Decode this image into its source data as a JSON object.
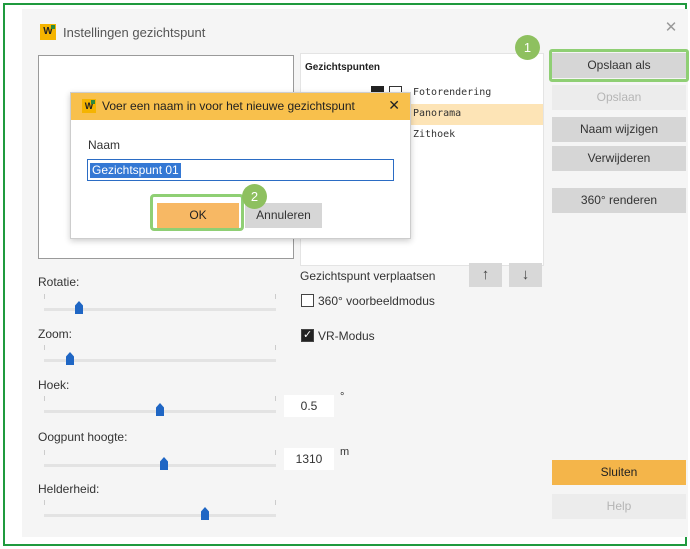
{
  "window": {
    "title": "Instellingen gezichtspunt",
    "icon": "app-logo-icon",
    "icon_letter": "W",
    "close_glyph": "✕"
  },
  "viewpoints": {
    "heading": "Gezichtspunten",
    "items": [
      {
        "label": "Fotorendering",
        "selected": false
      },
      {
        "label": "Panorama",
        "selected": true
      },
      {
        "label": "Zithoek",
        "selected": false
      }
    ]
  },
  "buttons": {
    "save_as": "Opslaan als",
    "save": "Opslaan",
    "rename": "Naam wijzigen",
    "delete": "Verwijderen",
    "render360": "360° renderen",
    "close": "Sluiten",
    "help": "Help"
  },
  "move": {
    "label": "Gezichtspunt verplaatsen",
    "up_glyph": "↑",
    "down_glyph": "↓"
  },
  "options": {
    "preview360": {
      "label": "360° voorbeeldmodus",
      "checked": false
    },
    "vr": {
      "label": "VR-Modus",
      "checked": true
    }
  },
  "sliders": {
    "rotation": {
      "label": "Rotatie:",
      "level": 0.14
    },
    "zoom": {
      "label": "Zoom:",
      "level": 0.1
    },
    "angle": {
      "label": "Hoek:",
      "level": 0.5,
      "value": "0.5",
      "unit": "°"
    },
    "eye_height": {
      "label": "Oogpunt hoogte:",
      "level": 0.52,
      "value": "1310",
      "unit": "m"
    },
    "brightness": {
      "label": "Helderheid:",
      "level": 0.7
    }
  },
  "dialog": {
    "title": "Voer een naam in voor het nieuwe gezichtspunt",
    "name_label": "Naam",
    "name_value": "Gezichtspunt 01",
    "ok": "OK",
    "cancel": "Annuleren",
    "close_glyph": "✕"
  },
  "badges": {
    "step1": "1",
    "step2": "2"
  },
  "colors": {
    "accent": "#f4b54a",
    "highlight": "#8fcf74",
    "badge": "#8ec05f",
    "selection": "#fde4b6"
  }
}
